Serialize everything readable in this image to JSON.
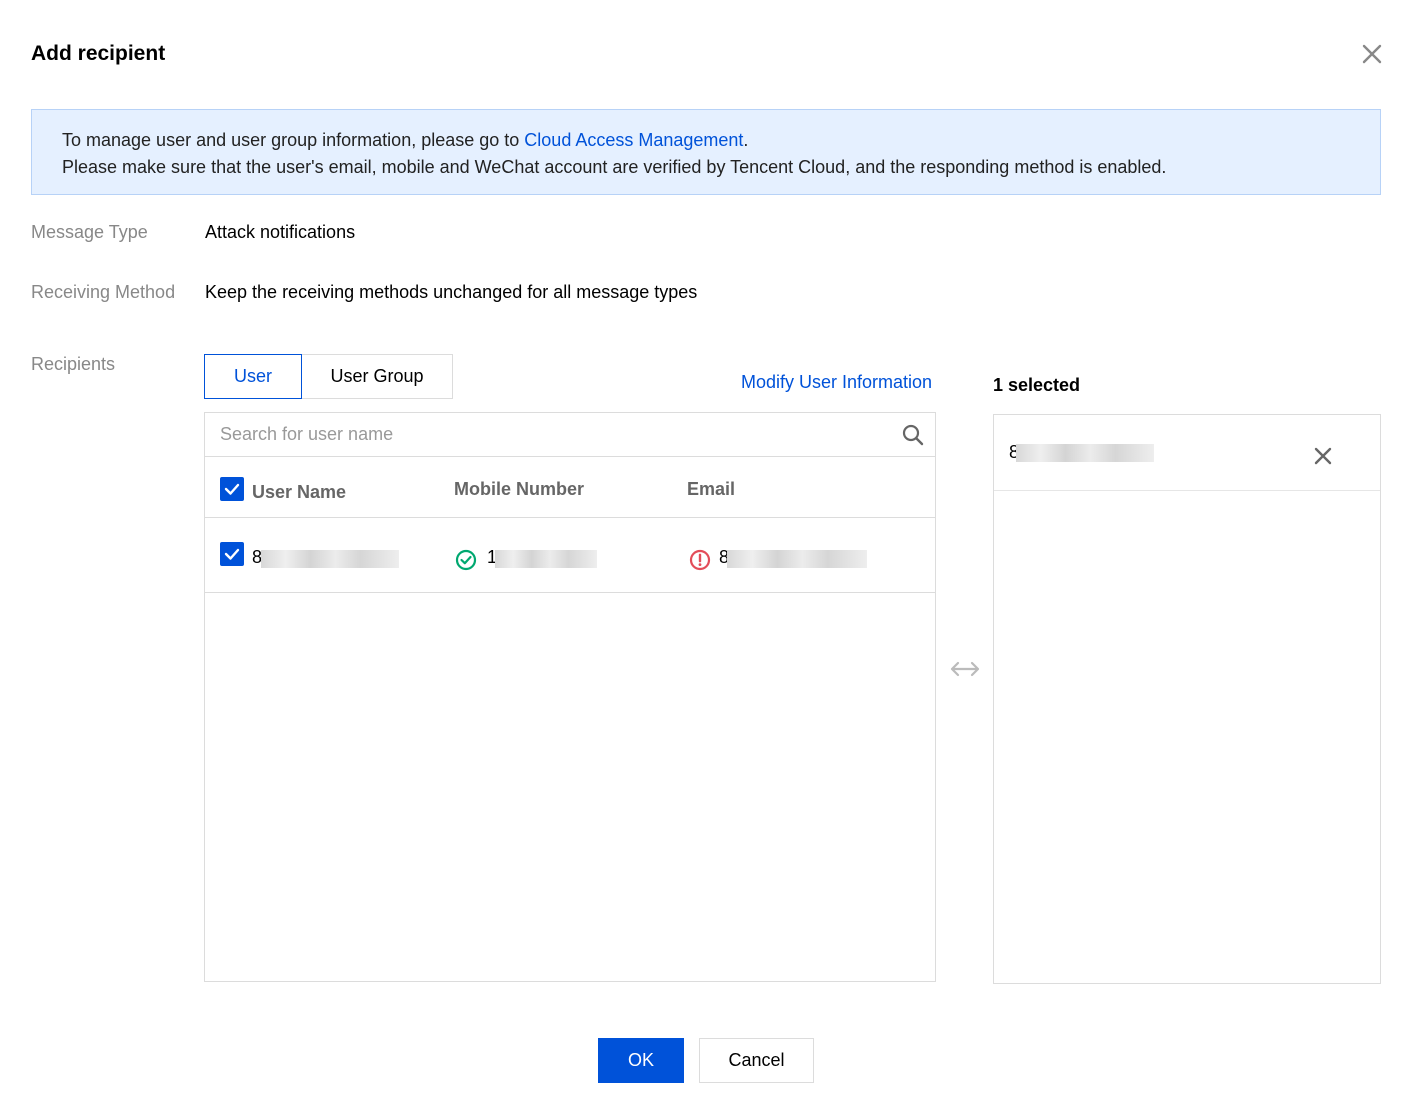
{
  "dialog": {
    "title": "Add recipient"
  },
  "notice": {
    "line1_prefix": "To manage user and user group information, please go to ",
    "line1_link": "Cloud Access Management",
    "line1_suffix": ".",
    "line2": "Please make sure that the user's email, mobile and WeChat account are verified by Tencent Cloud, and the responding method is enabled."
  },
  "form": {
    "message_type_label": "Message Type",
    "message_type_value": "Attack notifications",
    "receiving_method_label": "Receiving Method",
    "receiving_method_value": "Keep the receiving methods unchanged for all message types",
    "recipients_label": "Recipients"
  },
  "tabs": [
    {
      "label": "User",
      "active": true
    },
    {
      "label": "User Group",
      "active": false
    }
  ],
  "modify_link": "Modify User Information",
  "search": {
    "placeholder": "Search for user name",
    "value": ""
  },
  "table": {
    "columns": [
      "User Name",
      "Mobile Number",
      "Email"
    ],
    "rows": [
      {
        "checked": true,
        "user_name_prefix": "8",
        "mobile_prefix": "1",
        "mobile_status": "verified",
        "email_prefix": "8",
        "email_status": "unverified"
      }
    ]
  },
  "selected": {
    "title": "1 selected",
    "items": [
      {
        "name_prefix": "8"
      }
    ]
  },
  "buttons": {
    "ok": "OK",
    "cancel": "Cancel"
  },
  "colors": {
    "accent": "#0052d9",
    "success": "#00a870",
    "error": "#e34d59",
    "notice_bg": "#e5f0ff"
  },
  "icons": {
    "close": "close-icon",
    "search": "search-icon",
    "check": "check-icon",
    "verified": "check-circle-icon",
    "warning": "error-circle-icon",
    "transfer": "arrow-left-right-icon",
    "remove": "close-icon"
  }
}
